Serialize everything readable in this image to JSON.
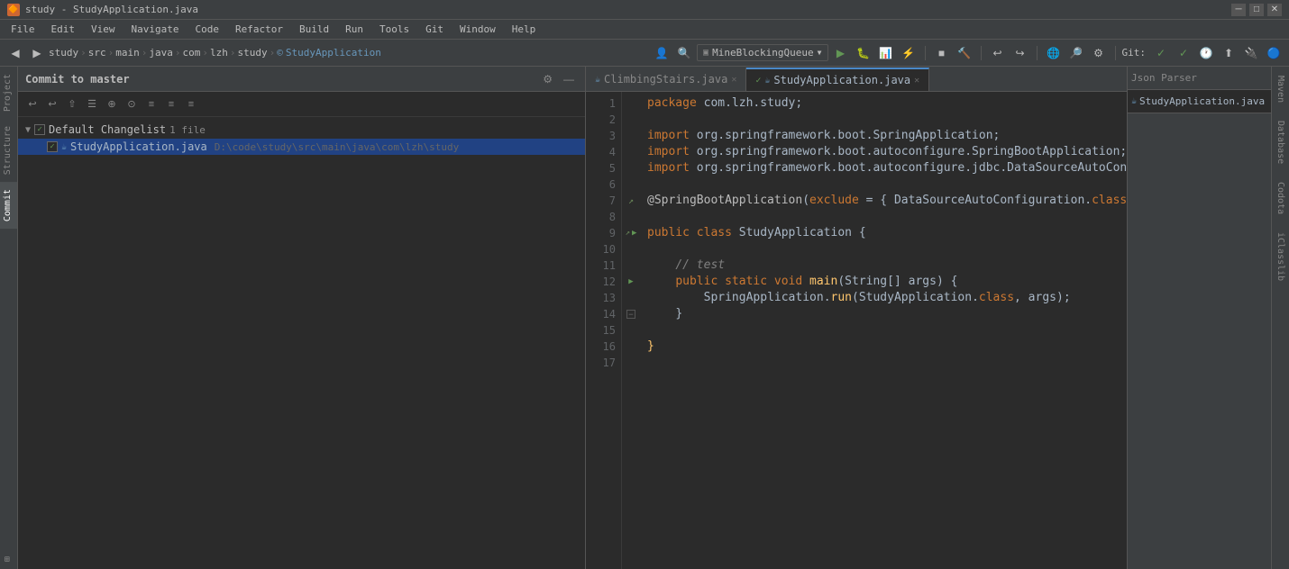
{
  "titlebar": {
    "icon": "🔶",
    "title": "study - StudyApplication.java",
    "controls": [
      "─",
      "□",
      "✕"
    ]
  },
  "menubar": {
    "items": [
      "File",
      "Edit",
      "View",
      "Navigate",
      "Code",
      "Refactor",
      "Build",
      "Run",
      "Tools",
      "Git",
      "Window",
      "Help"
    ]
  },
  "toolbar": {
    "breadcrumbs": [
      "study",
      "src",
      "main",
      "java",
      "com",
      "lzh",
      "study"
    ],
    "current_file": "StudyApplication",
    "run_config": "MineBlockingQueue",
    "git_label": "Git:"
  },
  "commit_panel": {
    "title": "Commit to master",
    "toolbar_icons": [
      "↩",
      "↩",
      "⇧",
      "☰",
      "⊕",
      "⊙",
      "≡",
      "≡",
      "≡"
    ],
    "changelist": {
      "name": "Default Changelist",
      "file_count": "1 file",
      "files": [
        {
          "name": "StudyApplication.java",
          "path": "D:\\code\\study\\src\\main\\java\\com\\lzh\\study"
        }
      ]
    }
  },
  "editor": {
    "tabs": [
      {
        "name": "ClimbingStairs.java",
        "active": false,
        "modified": false
      },
      {
        "name": "StudyApplication.java",
        "active": true,
        "modified": false,
        "check": true
      }
    ],
    "lines": [
      {
        "num": 1,
        "content": "package com.lzh.study;",
        "type": "package"
      },
      {
        "num": 2,
        "content": "",
        "type": "blank"
      },
      {
        "num": 3,
        "content": "import org.springframework.boot.SpringApplication;",
        "type": "import"
      },
      {
        "num": 4,
        "content": "import org.springframework.boot.autoconfigure.SpringBootApplication;",
        "type": "import"
      },
      {
        "num": 5,
        "content": "import org.springframework.boot.autoconfigure.jdbc.DataSourceAutoConfiguration;",
        "type": "import"
      },
      {
        "num": 6,
        "content": "",
        "type": "blank"
      },
      {
        "num": 7,
        "content": "@SpringBootApplication(exclude = { DataSourceAutoConfiguration.class })",
        "type": "annotation",
        "has_icon": true
      },
      {
        "num": 8,
        "content": "",
        "type": "blank"
      },
      {
        "num": 9,
        "content": "public class StudyApplication {",
        "type": "class",
        "has_icon": true,
        "has_run": true
      },
      {
        "num": 10,
        "content": "",
        "type": "blank"
      },
      {
        "num": 11,
        "content": "    // test",
        "type": "comment"
      },
      {
        "num": 12,
        "content": "    public static void main(String[] args) {",
        "type": "method",
        "has_run": true,
        "has_fold": true
      },
      {
        "num": 13,
        "content": "        SpringApplication.run(StudyApplication.class, args);",
        "type": "code"
      },
      {
        "num": 14,
        "content": "    }",
        "type": "code",
        "has_fold": true
      },
      {
        "num": 15,
        "content": "",
        "type": "blank"
      },
      {
        "num": 16,
        "content": "}",
        "type": "code"
      },
      {
        "num": 17,
        "content": "",
        "type": "blank"
      }
    ]
  },
  "right_panel": {
    "tabs": [
      {
        "name": "Json Parser",
        "active": false
      },
      {
        "name": "StudyApplication.java",
        "active": true
      }
    ],
    "vtabs": [
      {
        "name": "Maven"
      },
      {
        "name": "Database"
      },
      {
        "name": "Codota"
      },
      {
        "name": "iClasslib"
      }
    ]
  },
  "left_vtabs": [
    {
      "name": "Project",
      "active": false
    },
    {
      "name": "Structure",
      "active": false
    },
    {
      "name": "Commit",
      "active": true
    }
  ]
}
